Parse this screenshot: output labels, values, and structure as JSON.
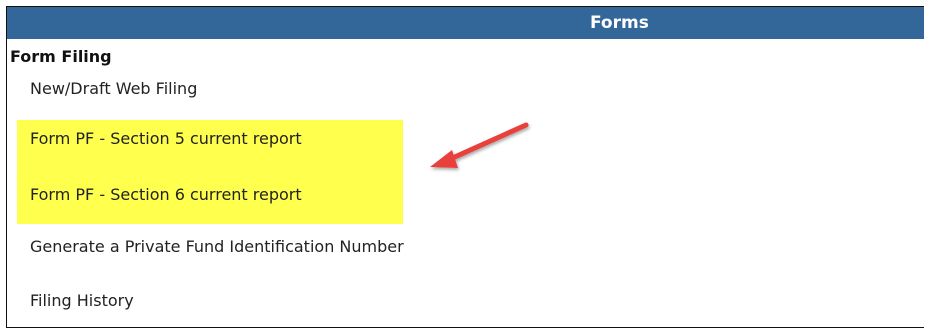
{
  "panel": {
    "header_title": "Forms",
    "section_title": "Form Filing",
    "links": [
      {
        "label": "New/Draft Web Filing"
      },
      {
        "label": "Form PF - Section 5 current report"
      },
      {
        "label": "Form PF - Section 6 current report"
      },
      {
        "label": "Generate a Private Fund Identification Number"
      },
      {
        "label": "Filing History"
      }
    ]
  },
  "colors": {
    "header_bg": "#336699",
    "highlight": "#ffff4d",
    "arrow": "#e8413b"
  }
}
